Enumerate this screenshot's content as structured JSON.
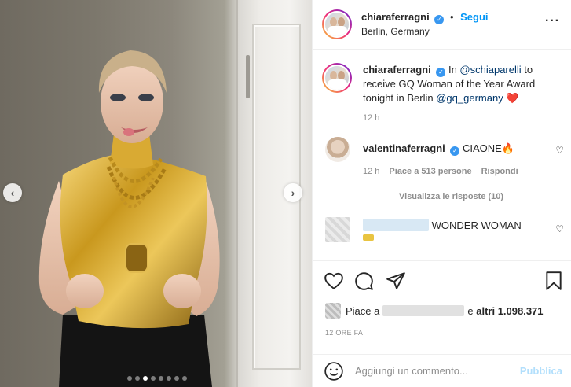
{
  "post": {
    "username": "chiaraferragni",
    "verified_glyph": "✓",
    "separator": "•",
    "follow_label": "Segui",
    "location": "Berlin, Germany",
    "more_glyph": "···",
    "photo_nav": {
      "prev_glyph": "‹",
      "next_glyph": "›",
      "slide_count": 8,
      "active_slide": 3
    }
  },
  "caption": {
    "username": "chiaraferragni",
    "text_before": "In ",
    "mention1": "@schiaparelli",
    "text_middle": " to receive GQ Woman of the Year Award tonight in Berlin ",
    "mention2": "@gq_germany",
    "emoji": "❤️",
    "time": "12 h"
  },
  "comments": [
    {
      "username": "valentinaferragni",
      "text": "CIAONE🔥",
      "time": "12 h",
      "likes": "Piace a 513 persone",
      "reply_label": "Rispondi",
      "heart_glyph": "♡",
      "replies_label": "Visualizza le risposte (10)"
    },
    {
      "text": "WONDER WOMAN",
      "heart_glyph": "♡"
    }
  ],
  "likes_row": {
    "prefix": "Piace a",
    "suffix": "e",
    "others": "altri 1.098.371"
  },
  "date_label": "12 ORE FA",
  "add_comment": {
    "placeholder": "Aggiungi un commento...",
    "publish_label": "Pubblica"
  },
  "colors": {
    "accent": "#0095f6",
    "publish_disabled": "#b2dffc",
    "verified": "#3897f0",
    "heart": "#ed1c24"
  },
  "icons": [
    "heart-icon",
    "comment-icon",
    "share-icon",
    "bookmark-icon",
    "emoji-icon",
    "verified-icon",
    "more-options-icon"
  ]
}
